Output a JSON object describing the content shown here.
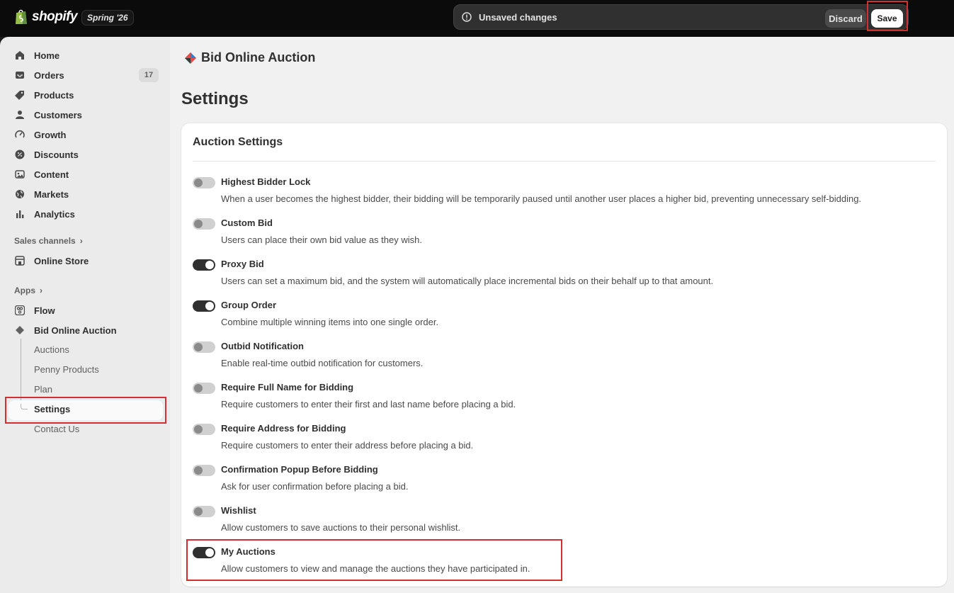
{
  "topbar": {
    "brand": "shopify",
    "edition": "Spring '26",
    "save_bar": {
      "message": "Unsaved changes",
      "discard_label": "Discard",
      "save_label": "Save"
    }
  },
  "sidebar": {
    "items": [
      {
        "label": "Home",
        "icon": "home-icon"
      },
      {
        "label": "Orders",
        "icon": "inbox-icon",
        "badge": "17"
      },
      {
        "label": "Products",
        "icon": "tag-icon"
      },
      {
        "label": "Customers",
        "icon": "person-icon"
      },
      {
        "label": "Growth",
        "icon": "gauge-icon"
      },
      {
        "label": "Discounts",
        "icon": "discount-icon"
      },
      {
        "label": "Content",
        "icon": "image-icon"
      },
      {
        "label": "Markets",
        "icon": "globe-icon"
      },
      {
        "label": "Analytics",
        "icon": "bar-chart-icon"
      }
    ],
    "sales_channels": {
      "label": "Sales channels",
      "items": [
        {
          "label": "Online Store",
          "icon": "store-icon"
        }
      ]
    },
    "apps": {
      "label": "Apps",
      "items": [
        {
          "label": "Flow",
          "icon": "flow-icon"
        },
        {
          "label": "Bid Online Auction",
          "icon": "auction-app-icon"
        }
      ],
      "sub_items": [
        "Auctions",
        "Penny Products",
        "Plan",
        "Settings",
        "Contact Us"
      ],
      "active_sub_item": "Settings"
    }
  },
  "main": {
    "app_title": "Bid Online Auction",
    "page_title": "Settings",
    "card": {
      "title": "Auction Settings",
      "settings": [
        {
          "label": "Highest Bidder Lock",
          "desc": "When a user becomes the highest bidder, their bidding will be temporarily paused until another user places a higher bid, preventing unnecessary self-bidding.",
          "enabled": false
        },
        {
          "label": "Custom Bid",
          "desc": "Users can place their own bid value as they wish.",
          "enabled": false
        },
        {
          "label": "Proxy Bid",
          "desc": "Users can set a maximum bid, and the system will automatically place incremental bids on their behalf up to that amount.",
          "enabled": true
        },
        {
          "label": "Group Order",
          "desc": "Combine multiple winning items into one single order.",
          "enabled": true
        },
        {
          "label": "Outbid Notification",
          "desc": "Enable real-time outbid notification for customers.",
          "enabled": false
        },
        {
          "label": "Require Full Name for Bidding",
          "desc": "Require customers to enter their first and last name before placing a bid.",
          "enabled": false
        },
        {
          "label": "Require Address for Bidding",
          "desc": "Require customers to enter their address before placing a bid.",
          "enabled": false
        },
        {
          "label": "Confirmation Popup Before Bidding",
          "desc": "Ask for user confirmation before placing a bid.",
          "enabled": false
        },
        {
          "label": "Wishlist",
          "desc": "Allow customers to save auctions to their personal wishlist.",
          "enabled": false
        },
        {
          "label": "My Auctions",
          "desc": "Allow customers to view and manage the auctions they have participated in.",
          "enabled": true
        }
      ]
    }
  },
  "colors": {
    "highlight": "#d32f2f",
    "toggle_on": "#303030",
    "toggle_off": "#d0d0d0"
  }
}
